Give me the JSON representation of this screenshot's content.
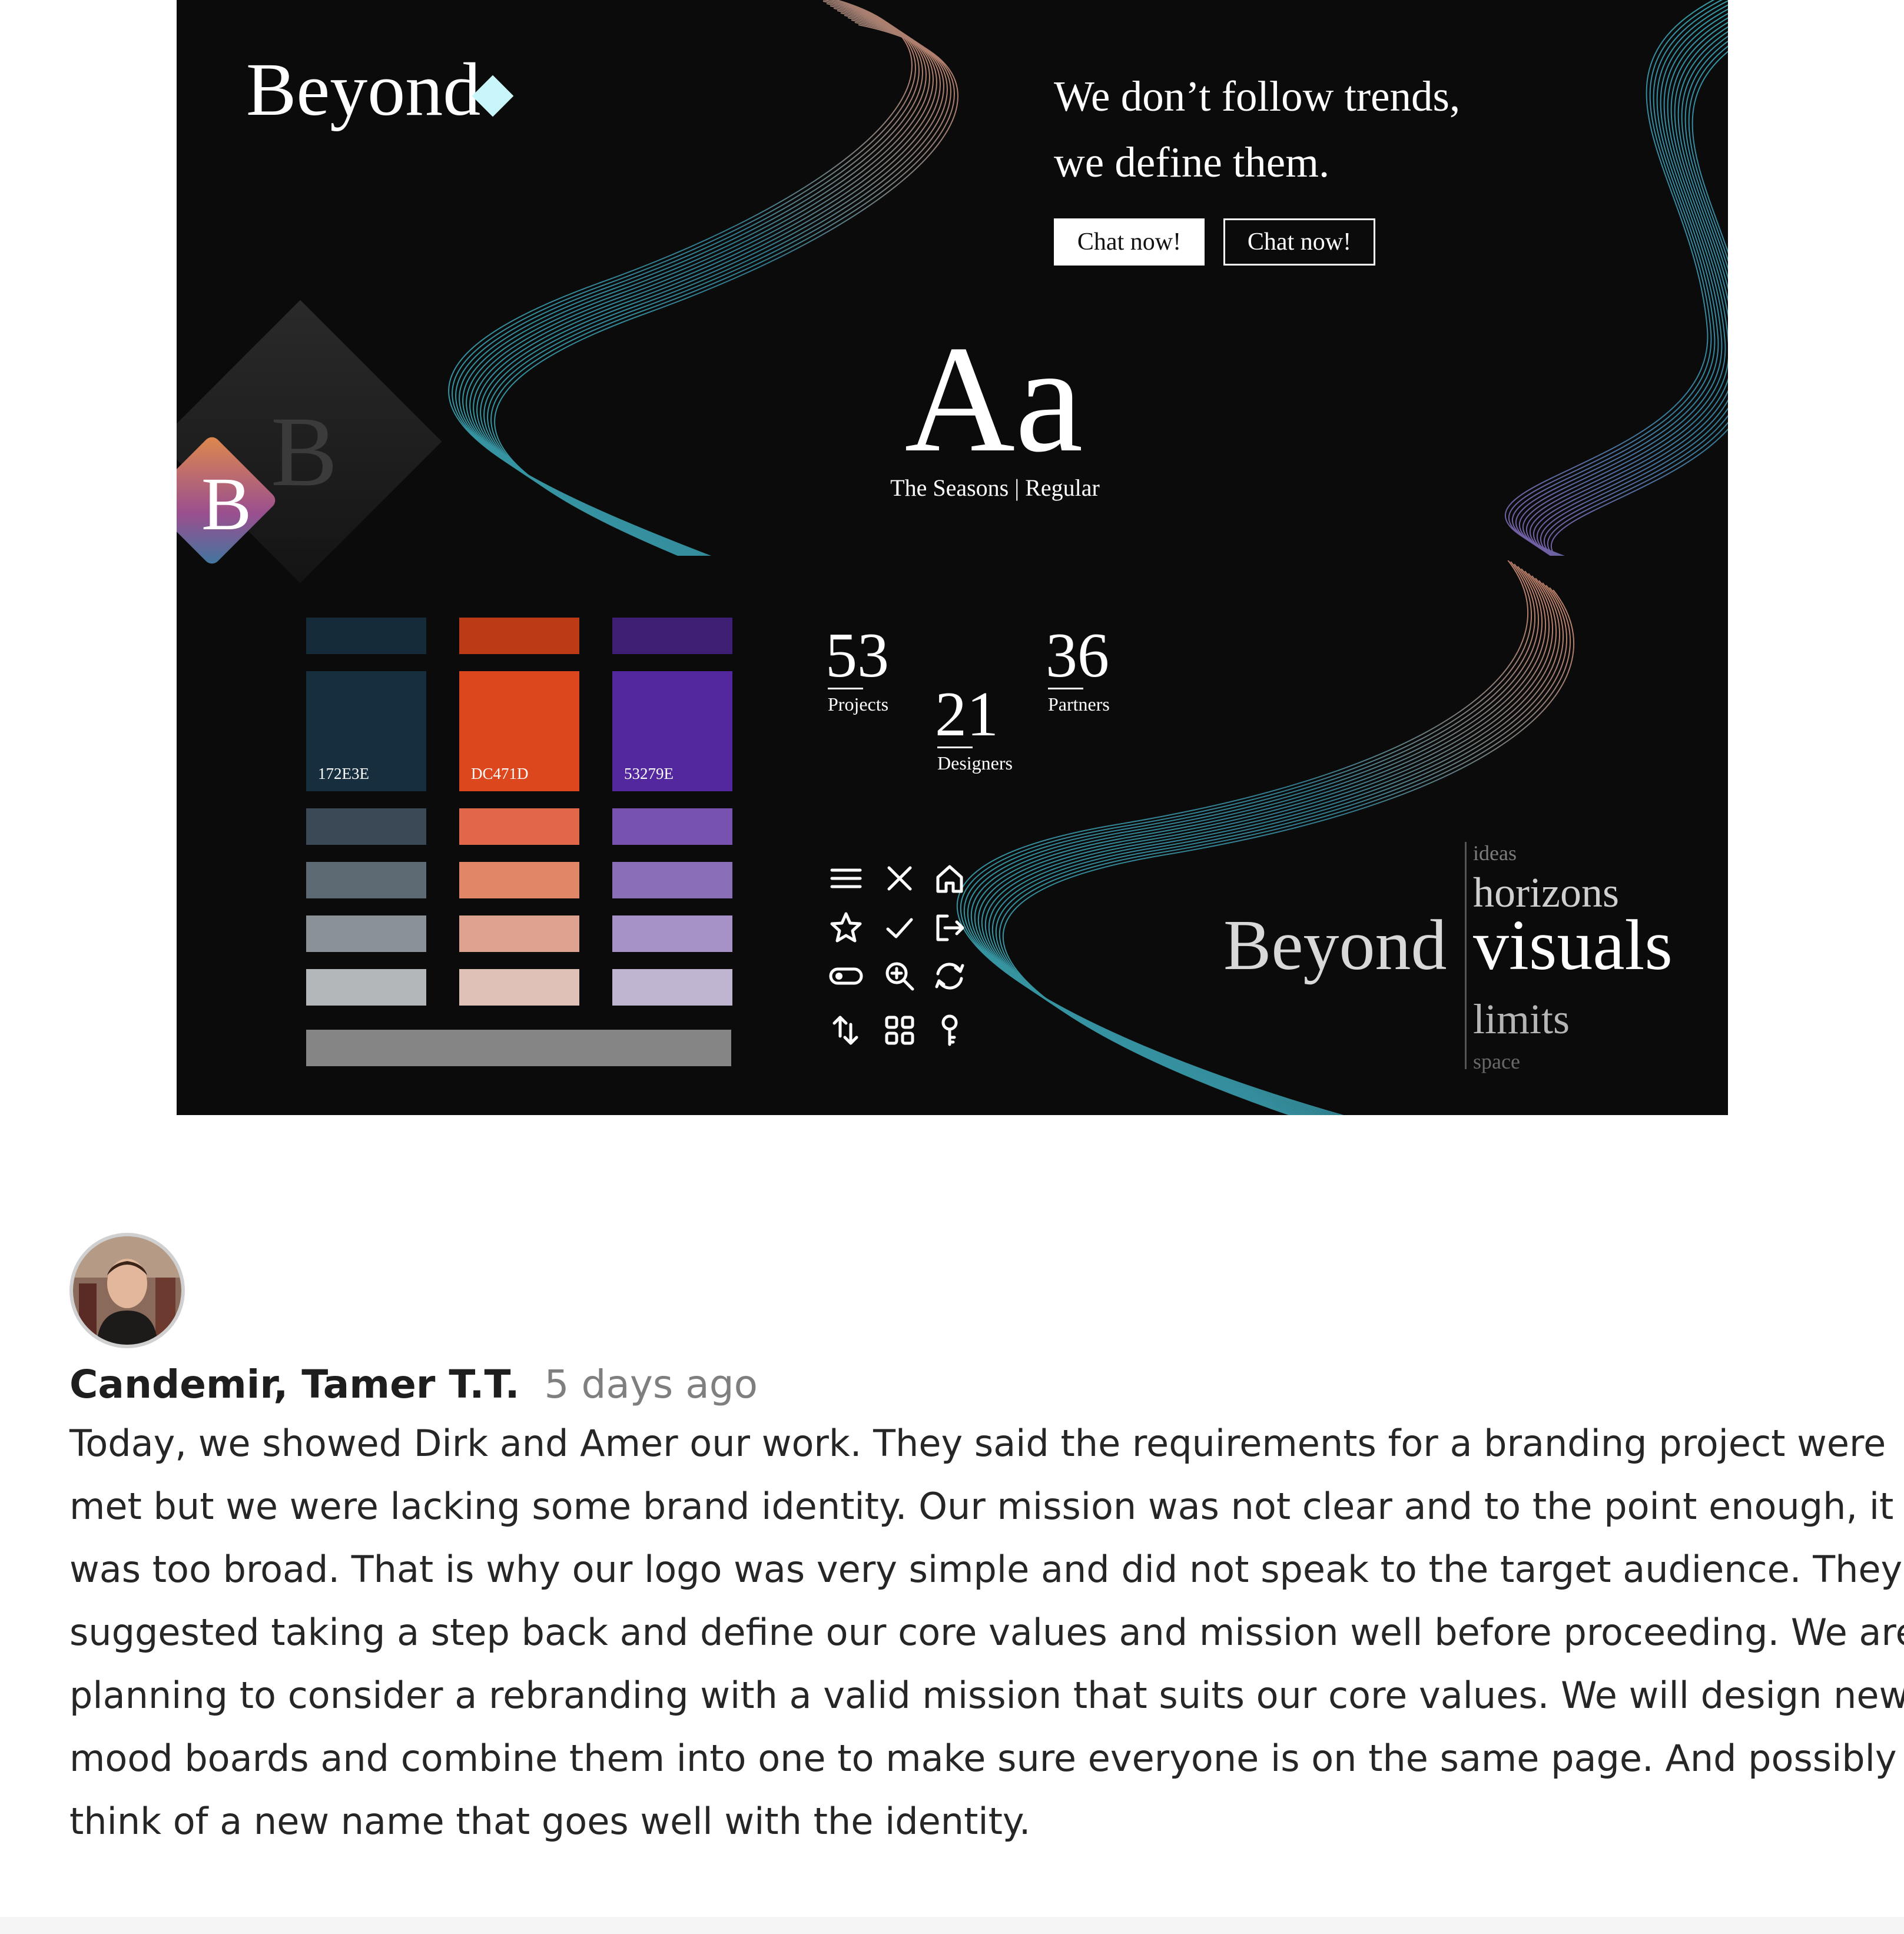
{
  "moodboard": {
    "brand_name": "Beyond",
    "tagline_lines": [
      "We don’t follow trends,",
      "we define them."
    ],
    "buttons": [
      "Chat now!",
      "Chat now!"
    ],
    "typeface_sample": "Aa",
    "typeface_name": "The Seasons | Regular",
    "logo_letter": "B",
    "palette": [
      {
        "hex": "172E3E",
        "label": "172E3E",
        "top": "#162b3a",
        "shades": [
          "#3a4955",
          "#5d6a74",
          "#8a9298",
          "#b3b7b9"
        ]
      },
      {
        "hex": "DC471D",
        "label": "DC471D",
        "top": "#bd3a17",
        "shades": [
          "#e2674a",
          "#e18666",
          "#dea390",
          "#dfc1b8"
        ]
      },
      {
        "hex": "53279E",
        "label": "53279E",
        "top": "#3e1f73",
        "shades": [
          "#7752ae",
          "#8a6fb7",
          "#a692c6",
          "#c0b5d1"
        ]
      }
    ],
    "neutral_color": "#858585",
    "stats": [
      {
        "number": "53",
        "label": "Projects"
      },
      {
        "number": "21",
        "label": "Designers"
      },
      {
        "number": "36",
        "label": "Partners"
      }
    ],
    "icons": [
      "menu-icon",
      "close-icon",
      "home-icon",
      "star-icon",
      "check-icon",
      "logout-icon",
      "toggle-icon",
      "zoom-in-icon",
      "refresh-icon",
      "sort-icon",
      "grid-icon",
      "key-icon"
    ],
    "word_cluster": {
      "main": "Beyond",
      "words": [
        "ideas",
        "horizons",
        "visuals",
        "limits",
        "space"
      ]
    },
    "colors": {
      "background": "#0b0b0b",
      "diamond": "#c8f6fb",
      "ribbon_teal": "#3fb7c4",
      "ribbon_peach": "#e3957a",
      "ribbon_purple": "#8a6cc0"
    }
  },
  "comment": {
    "author": "Candemir, Tamer T.T.",
    "time": "5 days ago",
    "body_lines": [
      "Today, we showed Dirk and Amer our work. They said the requirements for a branding project were",
      "met but we were lacking some brand identity. Our mission was not clear and to the point enough, it",
      "was too broad. That is why our logo was very simple and did not speak to the target audience. They",
      "suggested taking a step back and define our core values and mission well before proceeding. We are",
      "planning to consider a rebranding with a valid mission that suits our core values. We will design new",
      "mood boards and combine them into one to make sure everyone is on the same page. And possibly",
      "think of a new name that goes well with the identity."
    ]
  }
}
